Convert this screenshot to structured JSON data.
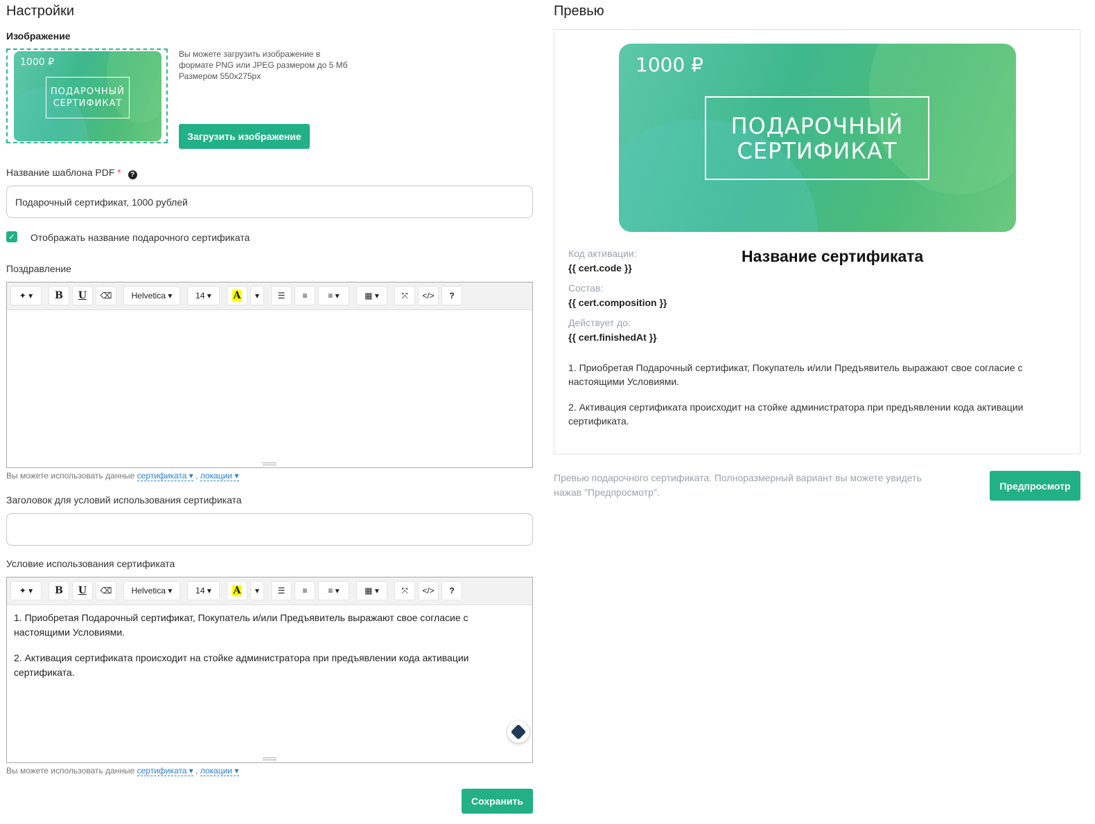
{
  "settings": {
    "title": "Настройки",
    "image_section_label": "Изображение",
    "image_hint_line1": "Вы можете загрузить изображение в",
    "image_hint_line2": "формате PNG или JPEG размером до 5 Мб",
    "image_hint_line3": "Размером 550x275px",
    "upload_button": "Загрузить изображение",
    "template_name_label": "Название шаблона PDF",
    "required_mark": "*",
    "template_name_value": "Подарочный сертификат, 1000 рублей",
    "show_name_checkbox_label": "Отображать название подарочного сертификата",
    "show_name_checked": true,
    "greeting_label": "Поздравление",
    "conditions_title_label": "Заголовок для условий использования сертификата",
    "conditions_title_value": "",
    "conditions_label": "Условие использования сертификата",
    "conditions_text": [
      "1. Приобретая Подарочный сертификат, Покупатель и/или Предъявитель выражают свое согласие с настоящими Условиями.",
      "2. Активация сертификата происходит на стойке администратора при предъявлении кода активации сертификата."
    ],
    "vars_hint_prefix": "Вы можете использовать данные",
    "vars_link_cert": "сертификата",
    "vars_sep": ",",
    "vars_link_location": "локации",
    "save_button": "Сохранить"
  },
  "editor_toolbar": {
    "font_name": "Helvetica",
    "font_size": "14",
    "bold": "B",
    "underline": "U",
    "highlight": "A",
    "code": "</>",
    "help": "?"
  },
  "certificate_card": {
    "price": "1000 ₽",
    "line1": "ПОДАРОЧНЫЙ",
    "line2": "СЕРТИФИКАТ"
  },
  "preview": {
    "title": "Превью",
    "cert_name": "Название сертификата",
    "activation_code_label": "Код активации:",
    "activation_code_value": "{{ cert.code }}",
    "composition_label": "Состав:",
    "composition_value": "{{ cert.composition }}",
    "valid_until_label": "Действует до:",
    "valid_until_value": "{{ cert.finishedAt }}",
    "terms": [
      "1. Приобретая Подарочный сертификат, Покупатель и/или Предъявитель выражают свое согласие с настоящими Условиями.",
      "2. Активация сертификата происходит на стойке администратора при предъявлении кода активации сертификата."
    ],
    "footer_line1": "Превью подарочного сертификата. Полноразмерный вариант вы можете увидеть",
    "footer_line2": "нажав \"Предпросмотр\".",
    "preview_button": "Предпросмотр"
  },
  "colors": {
    "accent": "#22b087",
    "link": "#2a7fd4"
  }
}
